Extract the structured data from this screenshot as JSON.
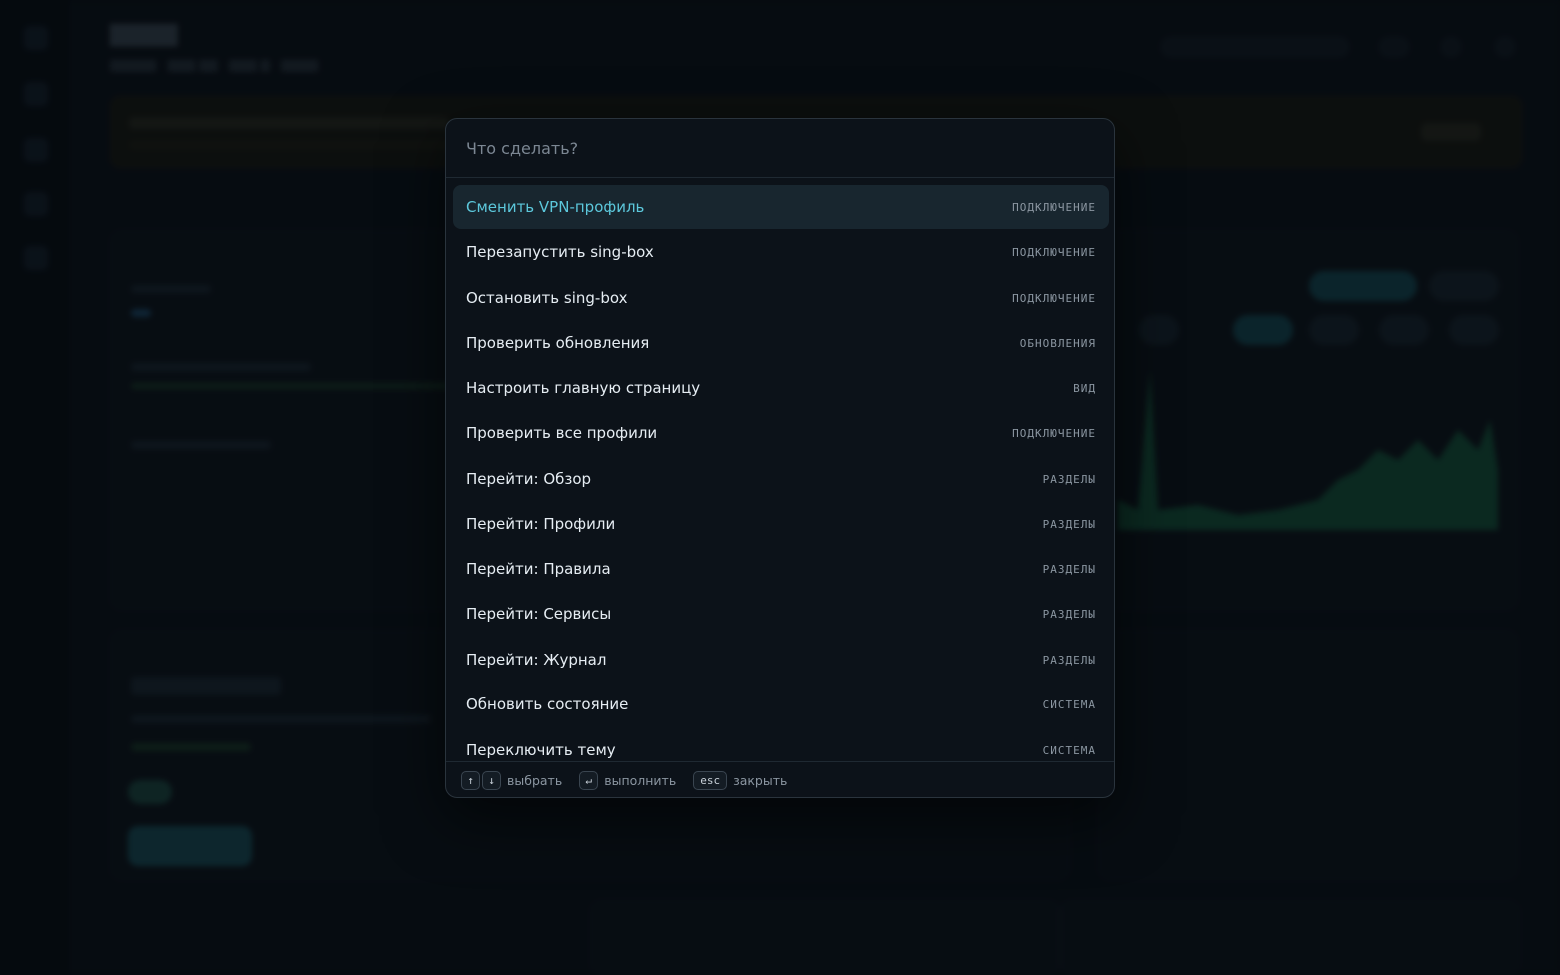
{
  "palette": {
    "search_placeholder": "Что сделать?",
    "commands": [
      {
        "label": "Сменить VPN-профиль",
        "category": "ПОДКЛЮЧЕНИЕ",
        "active": true
      },
      {
        "label": "Перезапустить sing-box",
        "category": "ПОДКЛЮЧЕНИЕ"
      },
      {
        "label": "Остановить sing-box",
        "category": "ПОДКЛЮЧЕНИЕ"
      },
      {
        "label": "Проверить обновления",
        "category": "ОБНОВЛЕНИЯ"
      },
      {
        "label": "Настроить главную страницу",
        "category": "ВИД"
      },
      {
        "label": "Проверить все профили",
        "category": "ПОДКЛЮЧЕНИЕ"
      },
      {
        "label": "Перейти: Обзор",
        "category": "РАЗДЕЛЫ"
      },
      {
        "label": "Перейти: Профили",
        "category": "РАЗДЕЛЫ"
      },
      {
        "label": "Перейти: Правила",
        "category": "РАЗДЕЛЫ"
      },
      {
        "label": "Перейти: Сервисы",
        "category": "РАЗДЕЛЫ"
      },
      {
        "label": "Перейти: Журнал",
        "category": "РАЗДЕЛЫ"
      },
      {
        "label": "Обновить состояние",
        "category": "СИСТЕМА"
      },
      {
        "label": "Переключить тему",
        "category": "СИСТЕМА"
      }
    ],
    "footer": {
      "up_key": "↑",
      "down_key": "↓",
      "select_label": "выбрать",
      "enter_key": "↵",
      "execute_label": "выполнить",
      "esc_key": "esc",
      "close_label": "закрыть"
    }
  },
  "colors": {
    "accent": "#5cc8dc",
    "active_row": "#18262f"
  }
}
